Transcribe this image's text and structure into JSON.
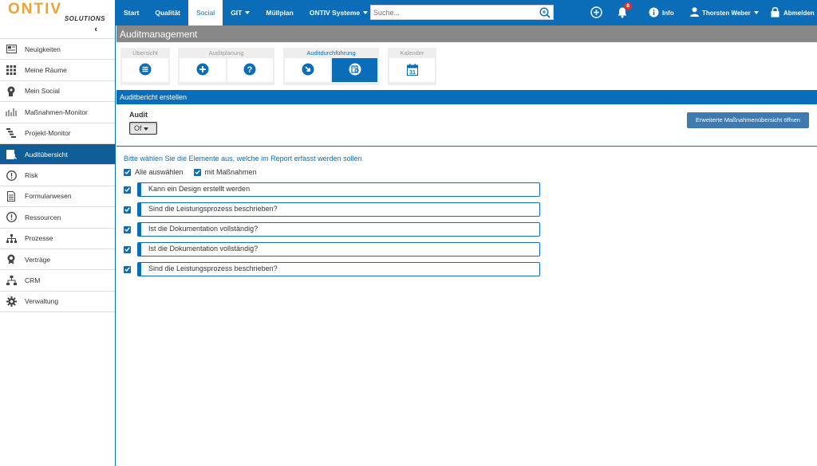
{
  "logo": {
    "main": "ONTIV",
    "sub": "SOLUTIONS"
  },
  "sidebar": {
    "collapse_icon": "chevron-left-icon",
    "items": [
      {
        "label": "Neuigkeiten",
        "icon": "newspaper-icon",
        "active": false
      },
      {
        "label": "Meine Räume",
        "icon": "grid-icon",
        "active": false
      },
      {
        "label": "Mein Social",
        "icon": "head-icon",
        "active": false
      },
      {
        "label": "Maßnahmen-Monitor",
        "icon": "bar-chart-icon",
        "active": false
      },
      {
        "label": "Projekt-Monitor",
        "icon": "gantt-icon",
        "active": false
      },
      {
        "label": "Auditübersicht",
        "icon": "audit-icon",
        "active": true
      },
      {
        "label": "Risk",
        "icon": "alert-icon",
        "active": false
      },
      {
        "label": "Formularwesen",
        "icon": "form-icon",
        "active": false
      },
      {
        "label": "Ressourcen",
        "icon": "alert-icon",
        "active": false
      },
      {
        "label": "Prozesse",
        "icon": "org-chart-icon",
        "active": false
      },
      {
        "label": "Verträge",
        "icon": "seal-icon",
        "active": false
      },
      {
        "label": "CRM",
        "icon": "network-icon",
        "active": false
      },
      {
        "label": "Verwaltung",
        "icon": "gear-icon",
        "active": false
      }
    ]
  },
  "topbar": {
    "nav": {
      "start": "Start",
      "qualitaet": "Qualität",
      "social": "Social",
      "git": "GIT",
      "muellplan": "Müllplan",
      "ontiv": "ONTIV Systeme"
    },
    "search_placeholder": "Suche...",
    "notifications_count": "8",
    "info": "Info",
    "user": "Thorsten Weber",
    "logout": "Abmelden"
  },
  "page": {
    "title": "Auditmanagement",
    "tab_groups": {
      "uebersicht": "Übersicht",
      "planung": "Auditplanung",
      "durchfuehrung": "Auditdurchführung",
      "kalender": "Kalender",
      "kalender_day": "31"
    },
    "section_title": "Auditbericht erstellen",
    "audit_label": "Audit",
    "audit_value": "Of",
    "ext_button": "Erweiterte Maßnahmenübersicht öffnen",
    "hint": "Bitte wählen Sie die Elemente aus, welche im Report erfasst werden sollen",
    "select_all": "Alle auswählen",
    "with_measures": "mit Maßnahmen",
    "items": [
      "Kann ein Design erstellt werden",
      "Sind die Leistungsprozess beschrieben?",
      "Ist die Dokumentation vollständig?",
      "Ist die Dokumentation vollständig?",
      "Sind die Leistungsprozess beschrieben?"
    ]
  },
  "colors": {
    "primary": "#0b6db8",
    "header_gray": "#888888",
    "logo_orange": "#f0a230",
    "button": "#3e7ab0"
  }
}
